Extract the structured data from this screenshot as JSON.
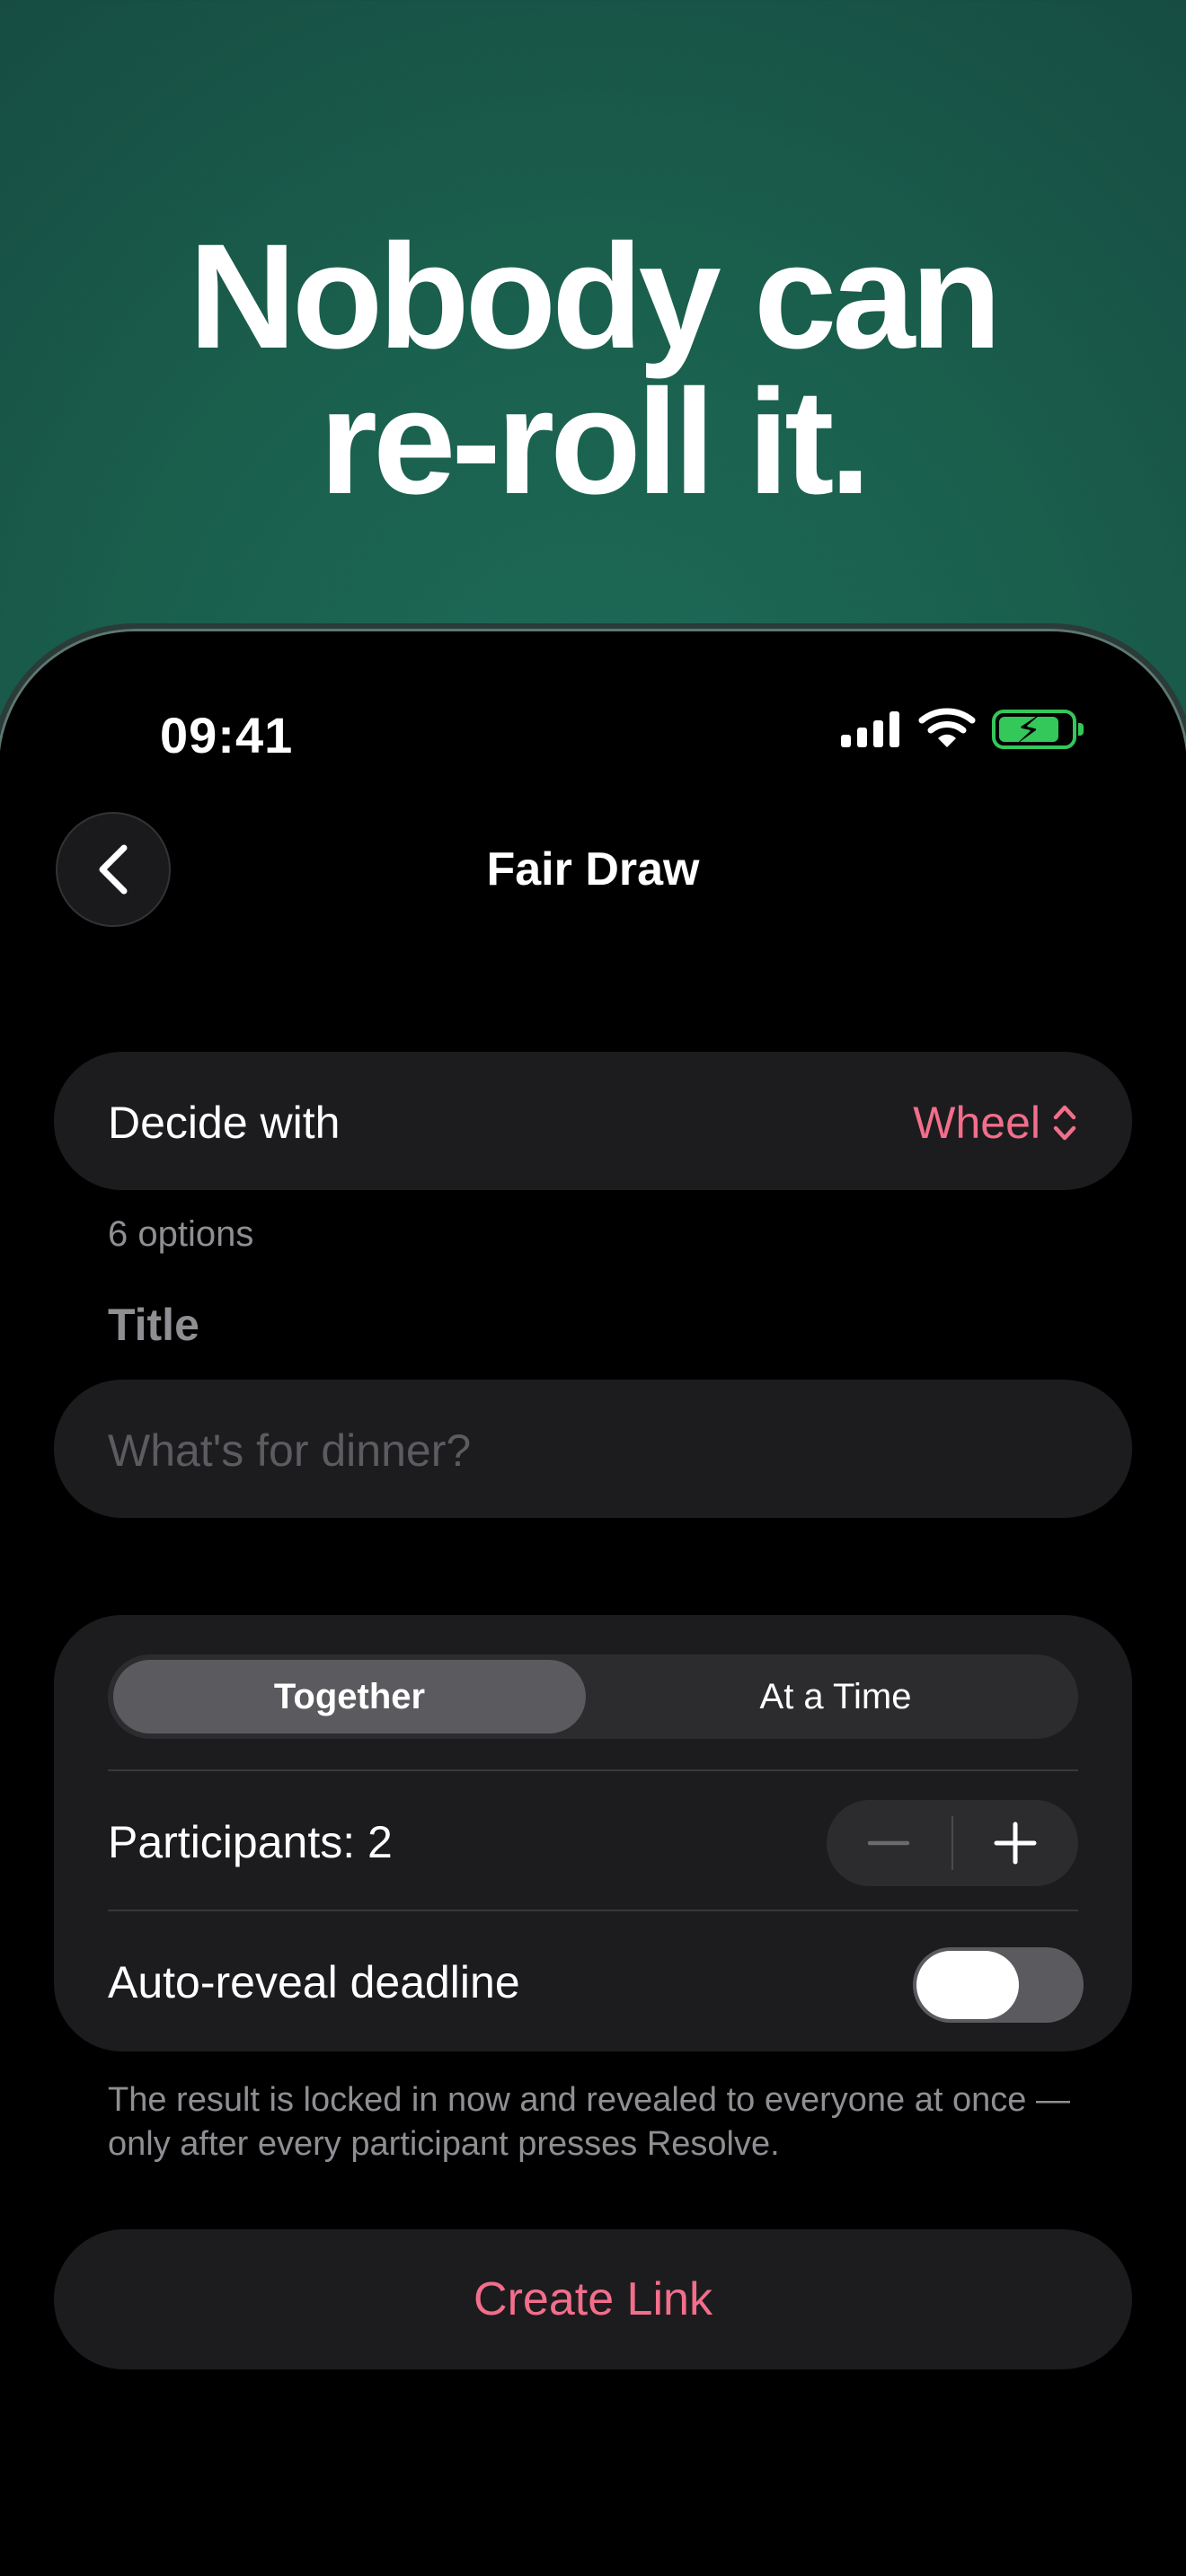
{
  "headline": {
    "line1": "Nobody can",
    "line2": "re-roll it."
  },
  "status": {
    "time": "09:41"
  },
  "nav": {
    "title": "Fair Draw",
    "back_icon": "chevron-left-icon"
  },
  "decide": {
    "label": "Decide with",
    "value": "Wheel",
    "caption": "6 options"
  },
  "title_field": {
    "section": "Title",
    "placeholder": "What's for dinner?"
  },
  "mode": {
    "options": [
      "Together",
      "At a Time"
    ],
    "selected": "Together"
  },
  "participants": {
    "label": "Participants: 2",
    "value": 2
  },
  "deadline": {
    "label": "Auto-reveal deadline",
    "enabled": false
  },
  "footnote": "The result is locked in now and revealed to everyone at once — only after every participant presses Resolve.",
  "cta": {
    "label": "Create Link"
  },
  "colors": {
    "accent": "#f26e8b",
    "battery": "#34c759",
    "card": "#1c1c1e"
  }
}
